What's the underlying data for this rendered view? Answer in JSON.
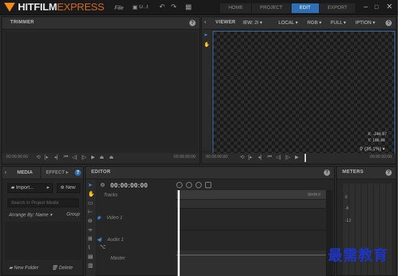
{
  "app": {
    "logo_primary": "HITFILM",
    "logo_secondary": "EXPRESS",
    "menu_file": "File",
    "project_name": "U...t",
    "workspace_tabs": [
      "HOME",
      "PROJECT",
      "EDIT",
      "EXPORT"
    ],
    "active_tab": "EDIT",
    "accent_color": "#2e6fb8",
    "logo_color": "#f08a1c"
  },
  "trimmer": {
    "title": "TRIMMER",
    "timecode_in": "00:00:00:00",
    "timecode_out": "00:00:00:00"
  },
  "viewer": {
    "title": "VIEWER",
    "view_select": "IEW: 2I",
    "space_select": "LOCAL",
    "channel_select": "RGB",
    "quality_select": "FULL",
    "options_select": "IPTION",
    "coord_x": "X: -246.97",
    "coord_y": "Y: 186.86",
    "zoom": "(36.1%)",
    "timecode_in": "00:00:00:00",
    "timecode_out": "00:00:00:00"
  },
  "media": {
    "tab_media": "MEDIA",
    "tab_effects": "EFFECT",
    "import_label": "Import...",
    "new_label": "New",
    "search_placeholder": "Search In Project Media",
    "arrange_label": "Arrange By: Name",
    "group_label": "Group",
    "new_folder_label": "New Folder",
    "delete_label": "Delete"
  },
  "editor": {
    "title": "EDITOR",
    "timecode": "00:00:00:00",
    "tracks_label": "Tracks",
    "video_track": "Video 1",
    "audio_track": "Audio 1",
    "master_track": "Master",
    "ruler_time": "00:05:0"
  },
  "meters": {
    "title": "METERS",
    "labels": [
      "0",
      "-6",
      "-12"
    ]
  },
  "watermark": "最需教育"
}
